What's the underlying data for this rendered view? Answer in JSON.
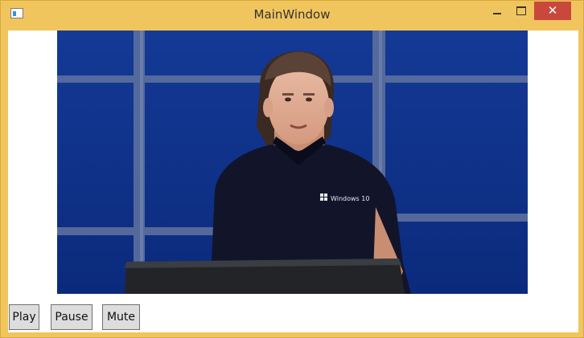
{
  "window": {
    "title": "MainWindow",
    "accent_color": "#f1c55e",
    "close_color": "#c9483c"
  },
  "icons": {
    "app": "app-icon",
    "minimize": "minimize-icon",
    "maximize": "maximize-icon",
    "close": "close-icon"
  },
  "controls": {
    "close_glyph": "✕"
  },
  "video": {
    "shirt_logo_text": "Windows 10"
  },
  "buttons": {
    "play": "Play",
    "pause": "Pause",
    "mute": "Mute"
  }
}
